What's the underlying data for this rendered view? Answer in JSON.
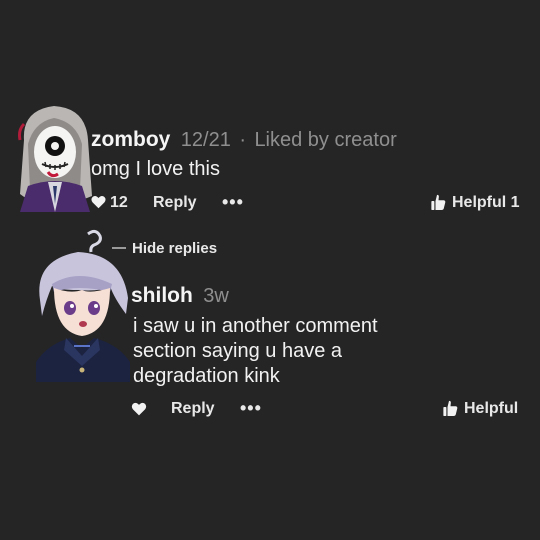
{
  "comment1": {
    "avatar": "avatar-zombie-character-icon",
    "username": "zomboy",
    "date": "12/21",
    "separator": "·",
    "liked_by": "Liked by creator",
    "text": "omg I love this",
    "like_count": "12",
    "reply_label": "Reply",
    "more_label": "•••",
    "helpful_label": "Helpful 1"
  },
  "thread": {
    "hide_replies_label": "Hide replies"
  },
  "comment2": {
    "avatar": "avatar-purple-hair-character-icon",
    "username": "shiloh",
    "age": "3w",
    "text_lines": [
      "i saw u in another comment",
      "section saying u have a",
      "degradation kink"
    ],
    "reply_label": "Reply",
    "more_label": "•••",
    "helpful_label": "Helpful"
  },
  "colors": {
    "background": "#252525",
    "primary_text": "#f2f2f2",
    "secondary_text": "#8f8f8f"
  }
}
